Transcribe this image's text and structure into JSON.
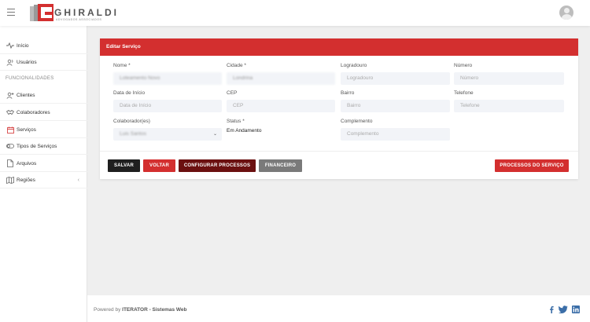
{
  "header": {
    "logo_text": "GHIRALDI",
    "logo_subtitle": "ADVOGADOS ASSOCIADOS"
  },
  "sidebar": {
    "section_label": "FUNCIONALIDADES",
    "items": [
      {
        "label": "Início",
        "icon": "activity-icon"
      },
      {
        "label": "Usuários",
        "icon": "users-icon"
      },
      {
        "label": "Clientes",
        "icon": "user-plus-icon"
      },
      {
        "label": "Colaboradores",
        "icon": "handshake-icon"
      },
      {
        "label": "Serviços",
        "icon": "calendar-icon"
      },
      {
        "label": "Tipos de Serviços",
        "icon": "toggle-icon"
      },
      {
        "label": "Arquivos",
        "icon": "file-icon"
      },
      {
        "label": "Regiões",
        "icon": "map-icon"
      }
    ]
  },
  "card": {
    "title": "Editar Serviço",
    "fields": {
      "nome": {
        "label": "Nome *",
        "value": "Loteamento Novo"
      },
      "cidade": {
        "label": "Cidade *",
        "value": "Londrina"
      },
      "logradouro": {
        "label": "Logradouro",
        "placeholder": "Logradouro"
      },
      "numero": {
        "label": "Número",
        "placeholder": "Número"
      },
      "data_inicio": {
        "label": "Data de Início",
        "placeholder": "Data de Início"
      },
      "cep": {
        "label": "CEP",
        "placeholder": "CEP"
      },
      "bairro": {
        "label": "Bairro",
        "placeholder": "Bairro"
      },
      "telefone": {
        "label": "Telefone",
        "placeholder": "Telefone"
      },
      "colaborador": {
        "label": "Colaborador(es)",
        "value": "Luis Santos"
      },
      "status": {
        "label": "Status *",
        "value": "Em Andamento"
      },
      "complemento": {
        "label": "Complemento",
        "placeholder": "Complemento"
      }
    },
    "buttons": {
      "salvar": "SALVAR",
      "voltar": "VOLTAR",
      "configurar": "CONFIGURAR PROCESSOS",
      "financeiro": "FINANCEIRO",
      "processos": "PROCESSOS DO SERVIÇO"
    }
  },
  "footer": {
    "prefix": "Powered by ",
    "brand": "ITERATOR - Sistemas Web"
  },
  "colors": {
    "accent": "#d32f2f",
    "dark_button": "#1f1f1f",
    "maroon_button": "#6b1010",
    "gray_button": "#7a7a7a"
  }
}
